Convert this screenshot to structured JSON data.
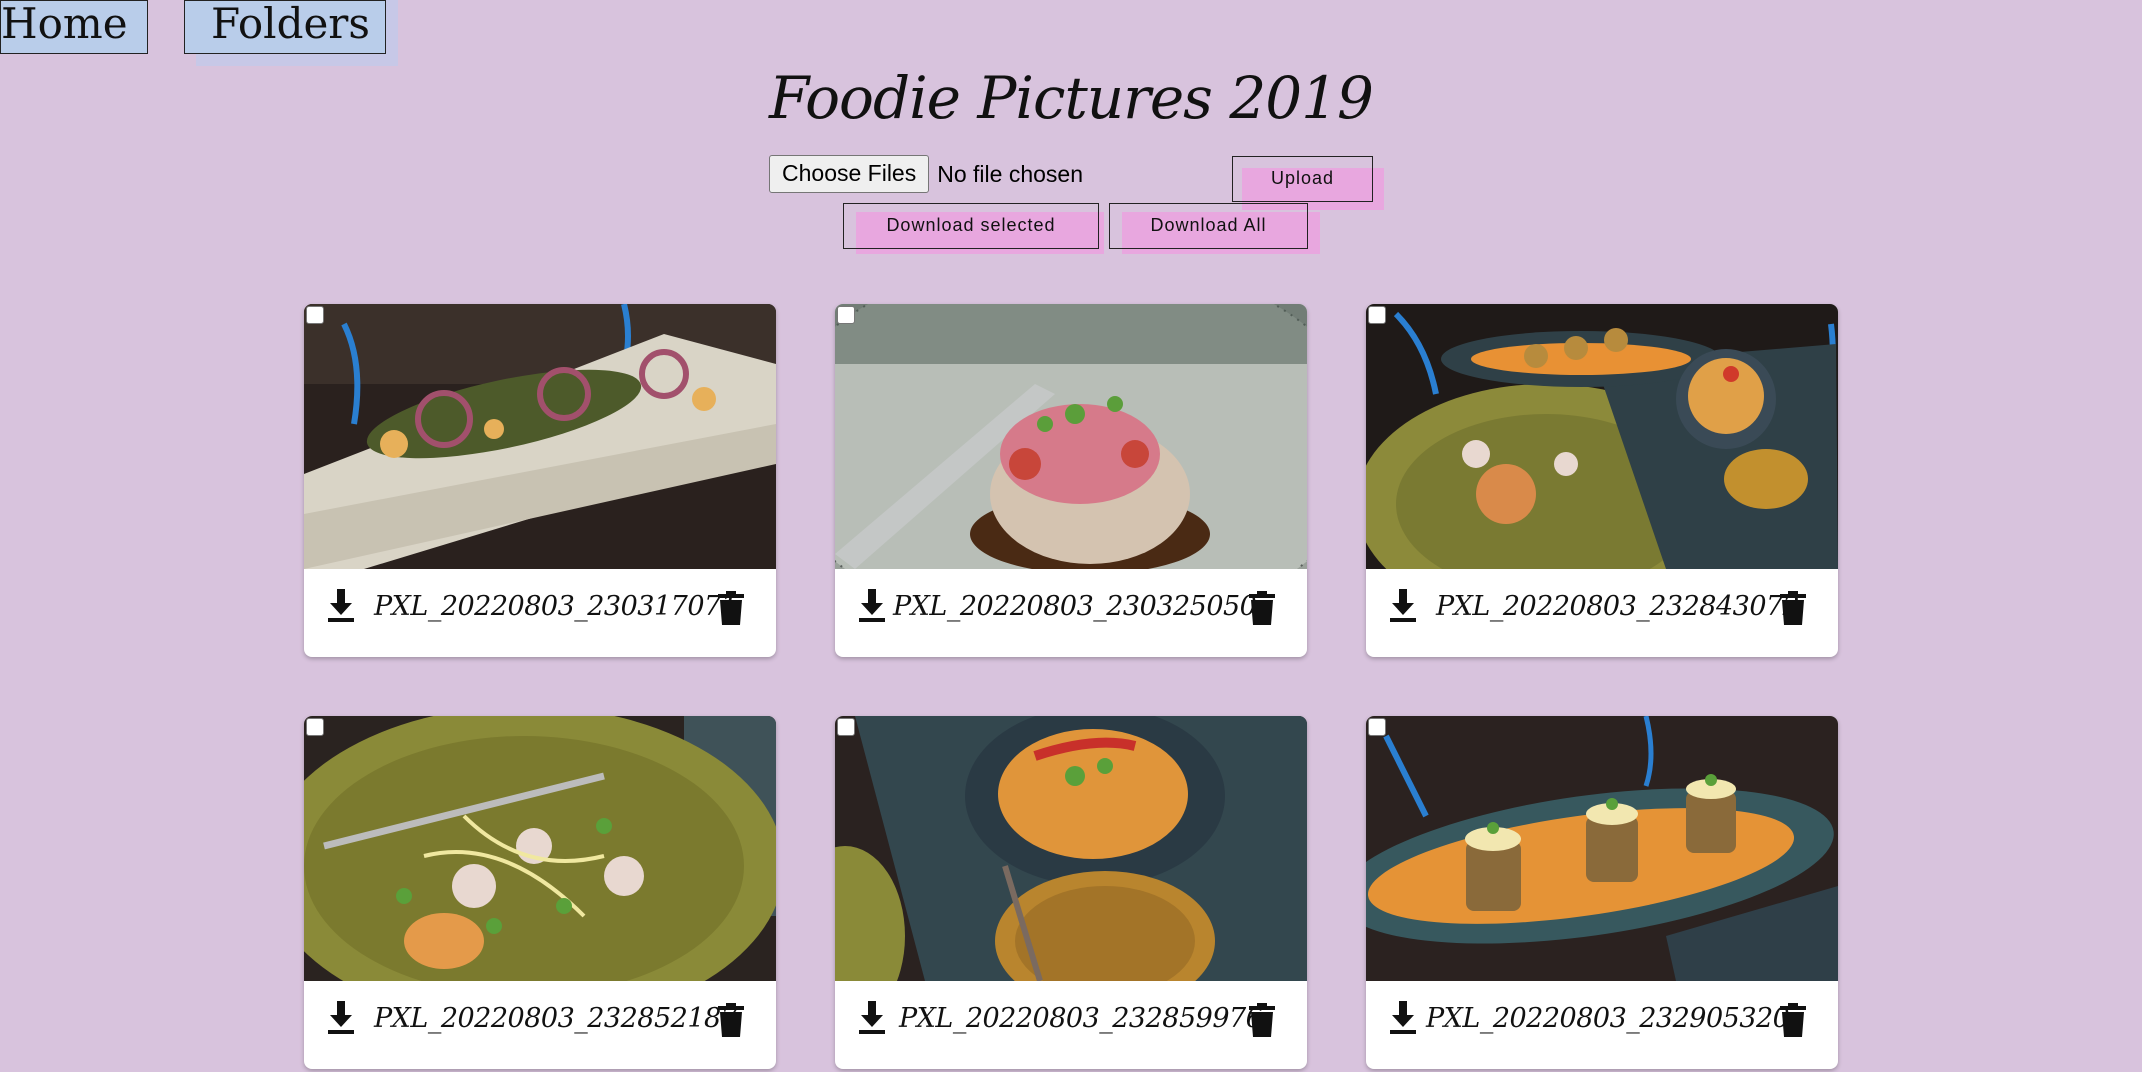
{
  "nav": {
    "home_label": "Home",
    "folders_label": "Folders"
  },
  "page": {
    "title": "Foodie Pictures 2019"
  },
  "upload": {
    "choose_files_label": "Choose Files",
    "file_status": "No file chosen",
    "upload_label": "Upload",
    "download_selected_label": "Download selected",
    "download_all_label": "Download All"
  },
  "photos": [
    {
      "filename": "PXL_20220803_230317071",
      "checked": false
    },
    {
      "filename": "PXL_20220803_230325050",
      "checked": false
    },
    {
      "filename": "PXL_20220803_232843072",
      "checked": false
    },
    {
      "filename": "PXL_20220803_232852187",
      "checked": false
    },
    {
      "filename": "PXL_20220803_232859976",
      "checked": false
    },
    {
      "filename": "PXL_20220803_232905320",
      "checked": false
    }
  ],
  "icons": {
    "download": "download-icon",
    "delete": "trash-icon"
  },
  "colors": {
    "background": "#d8c3dd",
    "nav_button": "#b9cdea",
    "action_highlight": "#e8a7df"
  }
}
